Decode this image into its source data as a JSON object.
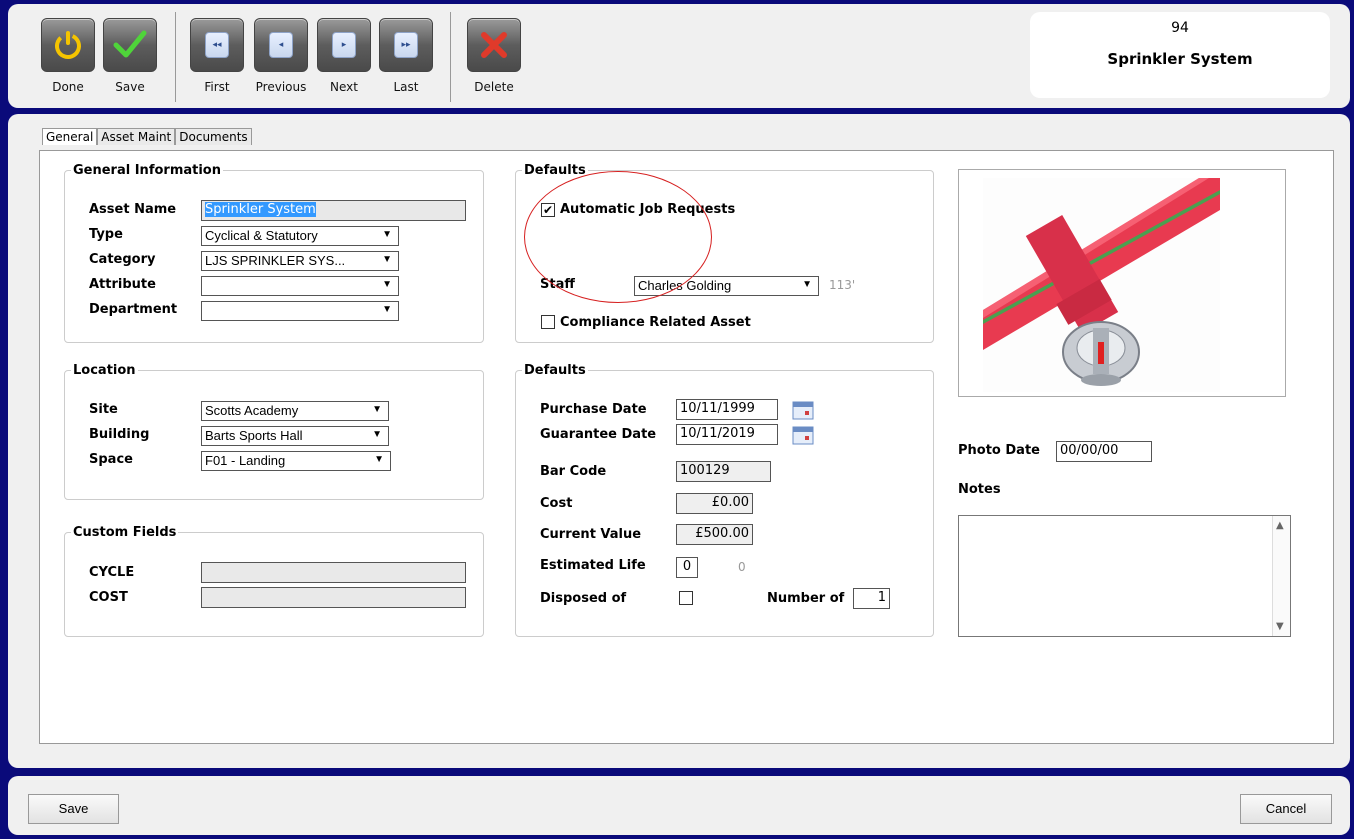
{
  "toolbar": {
    "done_label": "Done",
    "save_label": "Save",
    "first_label": "First",
    "previous_label": "Previous",
    "next_label": "Next",
    "last_label": "Last",
    "delete_label": "Delete"
  },
  "record": {
    "id": "94",
    "name": "Sprinkler System"
  },
  "tabs": [
    {
      "label": "General",
      "active": true
    },
    {
      "label": "Asset Maint",
      "active": false
    },
    {
      "label": "Documents",
      "active": false
    }
  ],
  "general_info": {
    "legend": "General Information",
    "asset_name_label": "Asset Name",
    "asset_name": "Sprinkler System",
    "type_label": "Type",
    "type": "Cyclical & Statutory",
    "category_label": "Category",
    "category": "LJS SPRINKLER SYS...",
    "attribute_label": "Attribute",
    "attribute": "",
    "department_label": "Department",
    "department": ""
  },
  "location": {
    "legend": "Location",
    "site_label": "Site",
    "site": "Scotts Academy",
    "building_label": "Building",
    "building": "Barts Sports Hall",
    "space_label": "Space",
    "space": "F01 - Landing"
  },
  "custom_fields": {
    "legend": "Custom Fields",
    "cycle_label": "CYCLE",
    "cycle": "",
    "cost_label": "COST",
    "cost": ""
  },
  "defaults_top": {
    "legend": "Defaults",
    "auto_job_label": "Automatic Job Requests",
    "auto_job_checked": true,
    "staff_label": "Staff",
    "staff": "Charles Golding",
    "staff_code": "113'",
    "compliance_label": "Compliance Related Asset",
    "compliance_checked": false
  },
  "defaults_bottom": {
    "legend": "Defaults",
    "purchase_date_label": "Purchase Date",
    "purchase_date": "10/11/1999",
    "guarantee_date_label": "Guarantee Date",
    "guarantee_date": "10/11/2019",
    "bar_code_label": "Bar Code",
    "bar_code": "100129",
    "cost_label": "Cost",
    "cost": "£0.00",
    "current_value_label": "Current Value",
    "current_value": "£500.00",
    "estimated_life_label": "Estimated Life",
    "estimated_life": "0",
    "estimated_life_extra": "0",
    "disposed_label": "Disposed of",
    "disposed_checked": false,
    "number_of_label": "Number of",
    "number_of": "1"
  },
  "photo": {
    "photo_date_label": "Photo Date",
    "photo_date": "00/00/00",
    "notes_label": "Notes",
    "notes": ""
  },
  "footer": {
    "save_label": "Save",
    "cancel_label": "Cancel"
  },
  "colors": {
    "frame": "#0a0a7a",
    "panel": "#f0f0f0",
    "highlight": "#3399ff",
    "annotation": "#d62020"
  }
}
